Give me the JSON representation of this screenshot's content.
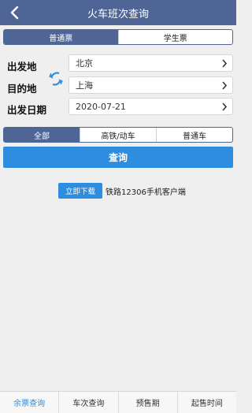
{
  "header": {
    "title": "火车班次查询",
    "back_icon": "back-arrow-icon"
  },
  "ticket_type_tabs": [
    {
      "label": "普通票",
      "active": true
    },
    {
      "label": "学生票",
      "active": false
    }
  ],
  "form": {
    "from_label": "出发地",
    "from_value": "北京",
    "to_label": "目的地",
    "to_value": "上海",
    "date_label": "出发日期",
    "date_value": "2020-07-21",
    "swap_icon": "swap-arrows-icon"
  },
  "train_type_tabs": [
    {
      "label": "全部",
      "active": true
    },
    {
      "label": "高铁/动车",
      "active": false
    },
    {
      "label": "普通车",
      "active": false
    }
  ],
  "query_button": "查询",
  "download": {
    "button": "立即下载",
    "text": "铁路12306手机客户端"
  },
  "bottom_tabs": [
    {
      "label": "余票查询",
      "active": true
    },
    {
      "label": "车次查询",
      "active": false
    },
    {
      "label": "预售期",
      "active": false
    },
    {
      "label": "起售时间",
      "active": false
    }
  ],
  "colors": {
    "header": "#4f6596",
    "accent": "#2f8de0",
    "background": "#efefef"
  }
}
